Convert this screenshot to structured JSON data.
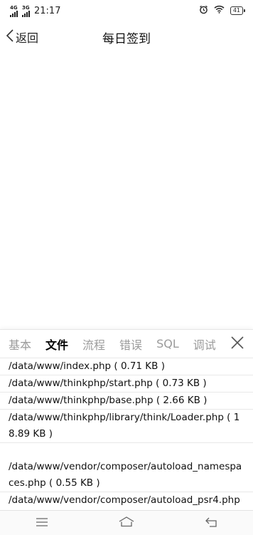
{
  "status": {
    "net1": "4G",
    "net2": "3G",
    "time": "21:17",
    "battery": "41"
  },
  "nav": {
    "back_label": "返回",
    "title": "每日签到"
  },
  "debug_panel": {
    "tabs": [
      "基本",
      "文件",
      "流程",
      "错误",
      "SQL",
      "调试"
    ],
    "active_tab": "文件",
    "files": [
      "/data/www/index.php ( 0.71 KB )",
      "/data/www/thinkphp/start.php ( 0.73 KB )",
      "/data/www/thinkphp/base.php ( 2.66 KB )",
      "/data/www/thinkphp/library/think/Loader.php ( 18.89 KB )",
      "/data/www/vendor/composer/autoload_namespaces.php ( 0.55 KB )",
      "/data/www/vendor/composer/autoload_psr4.php ("
    ]
  }
}
